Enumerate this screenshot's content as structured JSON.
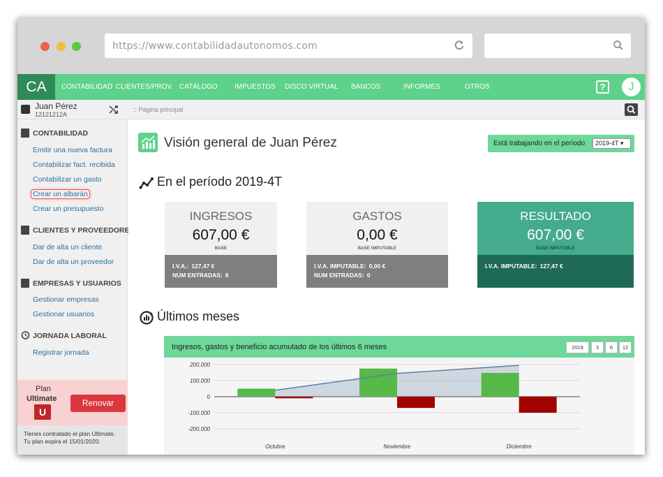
{
  "browser": {
    "url": "https://www.contabilidadautonomos.com",
    "dots": [
      "#ec5f56",
      "#f3b942",
      "#5bc94a"
    ]
  },
  "app": {
    "logo": "CA",
    "nav": [
      "CONTABILIDAD",
      "CLIENTES/PROV.",
      "CATÁLOGO",
      "IMPUESTOS",
      "DISCO VIRTUAL",
      "BANCOS",
      "INFORMES",
      "OTROS"
    ],
    "help": "?",
    "avatar": "J",
    "accent": "#5ed18b"
  },
  "user": {
    "name": "Juan Pérez",
    "nif": "12121212A"
  },
  "breadcrumb": ":: Página principal",
  "sidebar": {
    "sections": [
      {
        "title": "CONTABILIDAD",
        "links": [
          "Emitir una nueva factura",
          "Contabilizar fact. recibida",
          "Contabilizar un gasto",
          "Crear un albarán",
          "Crear un presupuesto"
        ]
      },
      {
        "title": "CLIENTES Y PROVEEDORES",
        "links": [
          "Dar de alta un cliente",
          "Dar de alta un proveedor"
        ]
      },
      {
        "title": "EMPRESAS Y USUARIOS",
        "links": [
          "Gestionar empresas",
          "Gestionar usuarios"
        ]
      },
      {
        "title": "JORNADA LABORAL",
        "links": [
          "Registrar jornada"
        ]
      }
    ],
    "plan": {
      "label": "Plan",
      "name": "Ultimate",
      "badge": "U",
      "renew": "Renovar",
      "info_line1": "Tienes contratado el plan Ultimate.",
      "info_line2": "Tu plan expira el 15/01/2020."
    }
  },
  "main": {
    "title": "Visión general de Juan Pérez",
    "period_label": "Está trabajando en el período",
    "period_value": "2019-4T ▾",
    "section1": "En el período 2019-4T",
    "section2": "Últimos meses",
    "cards": [
      {
        "title": "INGRESOS",
        "value": "607,00 €",
        "sub": "BASE",
        "rows": [
          {
            "k": "I.V.A.:",
            "v": "127,47 €"
          },
          {
            "k": "NUM ENTRADAS:",
            "v": "8"
          }
        ]
      },
      {
        "title": "GASTOS",
        "value": "0,00 €",
        "sub": "BASE IMPUTABLE",
        "rows": [
          {
            "k": "I.V.A. IMPUTABLE:",
            "v": "0,00 €"
          },
          {
            "k": "NUM ENTRADAS:",
            "v": "0"
          }
        ]
      },
      {
        "title": "RESULTADO",
        "value": "607,00 €",
        "sub": "BASE IMPUTABLE",
        "rows": [
          {
            "k": "I.V.A. IMPUTABLE:",
            "v": "127,47 €"
          }
        ]
      }
    ],
    "chart_title": "Ingresos, gastos y beneficio acumulado de los últimos 6 meses",
    "range_buttons": [
      "2019",
      "3",
      "6",
      "12"
    ]
  },
  "chart_data": {
    "type": "bar",
    "categories": [
      "Octubre",
      "Noviembre",
      "Diciembre"
    ],
    "series": [
      {
        "values": [
          50000,
          175000,
          148000
        ],
        "color": "#57b94a"
      },
      {
        "values": [
          -10000,
          -70000,
          -100000
        ],
        "color": "#a30000"
      },
      {
        "values": [
          40000,
          145000,
          195000
        ],
        "color": "#5c7fa3"
      }
    ],
    "yticks": [
      "200.000",
      "100.000",
      "0",
      "-100.000",
      "-200.000"
    ],
    "ylim": [
      -200000,
      200000
    ]
  }
}
